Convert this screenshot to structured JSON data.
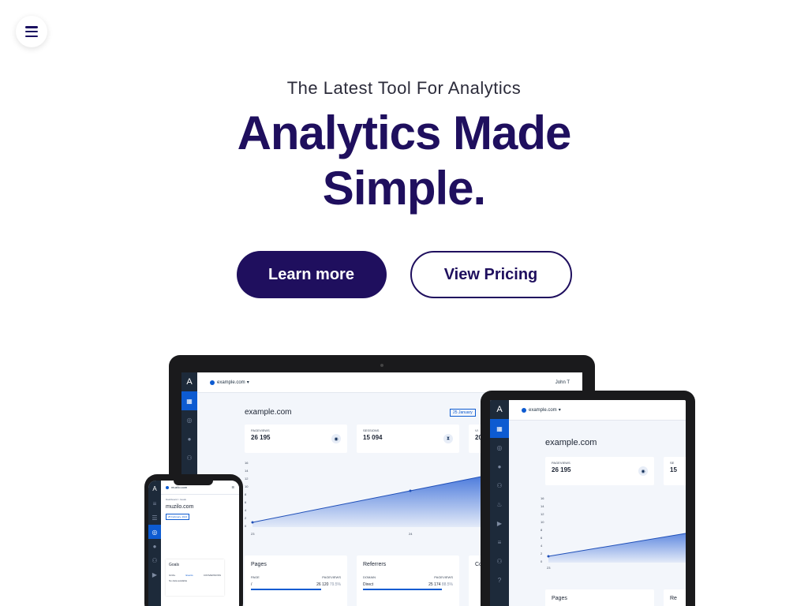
{
  "nav": {
    "menu_icon": "hamburger-icon"
  },
  "hero": {
    "subtitle": "The Latest Tool For Analytics",
    "headline_line1": "Analytics Made",
    "headline_line2": "Simple."
  },
  "buttons": {
    "learn_more": "Learn more",
    "view_pricing": "View Pricing"
  },
  "colors": {
    "brand": "#1f0f5e",
    "accent": "#0d5bd1"
  },
  "laptop": {
    "site_selector": "example.com",
    "user": "John T",
    "site_title": "example.com",
    "date_range": "25 January",
    "stats": [
      {
        "label": "PAGEVIEWS",
        "value": "26 195",
        "icon": "eye-icon"
      },
      {
        "label": "SESSIONS",
        "value": "15 094",
        "icon": "hourglass-icon"
      },
      {
        "label": "VI",
        "value": "20",
        "icon": ""
      }
    ],
    "chart": {
      "y_ticks": [
        "16",
        "14",
        "12",
        "10",
        "8",
        "6",
        "4",
        "2",
        "0"
      ],
      "x_ticks": [
        "23",
        "24"
      ]
    },
    "panels": [
      {
        "title": "Pages",
        "col1": "PAGE",
        "col2": "PAGEVIEWS",
        "row_label": "/",
        "row_value": "26 120",
        "row_pct": "79.5%"
      },
      {
        "title": "Referrers",
        "col1": "DOMAIN",
        "col2": "PAGEVIEWS",
        "row_label": "Direct",
        "row_value": "25 174",
        "row_pct": "88.5%"
      },
      {
        "title": "Co"
      }
    ]
  },
  "tablet": {
    "site_selector": "example.com",
    "site_title": "example.com",
    "stat_label": "PAGEVIEWS",
    "stat_value": "26 195",
    "stat_partial": "SE",
    "stat_partial_value": "15",
    "y_ticks": [
      "16",
      "14",
      "12",
      "10",
      "8",
      "6",
      "4",
      "2",
      "0"
    ],
    "x_tick": "23",
    "panel_title": "Pages",
    "panel2_title": "Re"
  },
  "phone": {
    "site_selector": "muzilo.com",
    "breadcrumb": "Dashboard  >  Goals",
    "site_title": "muzilo.com",
    "date": "25 February, 2021",
    "panel_title": "Goals",
    "col1": "GOAL",
    "col2": "Events",
    "col3": "CONVERSIONS",
    "empty": "No data available"
  }
}
